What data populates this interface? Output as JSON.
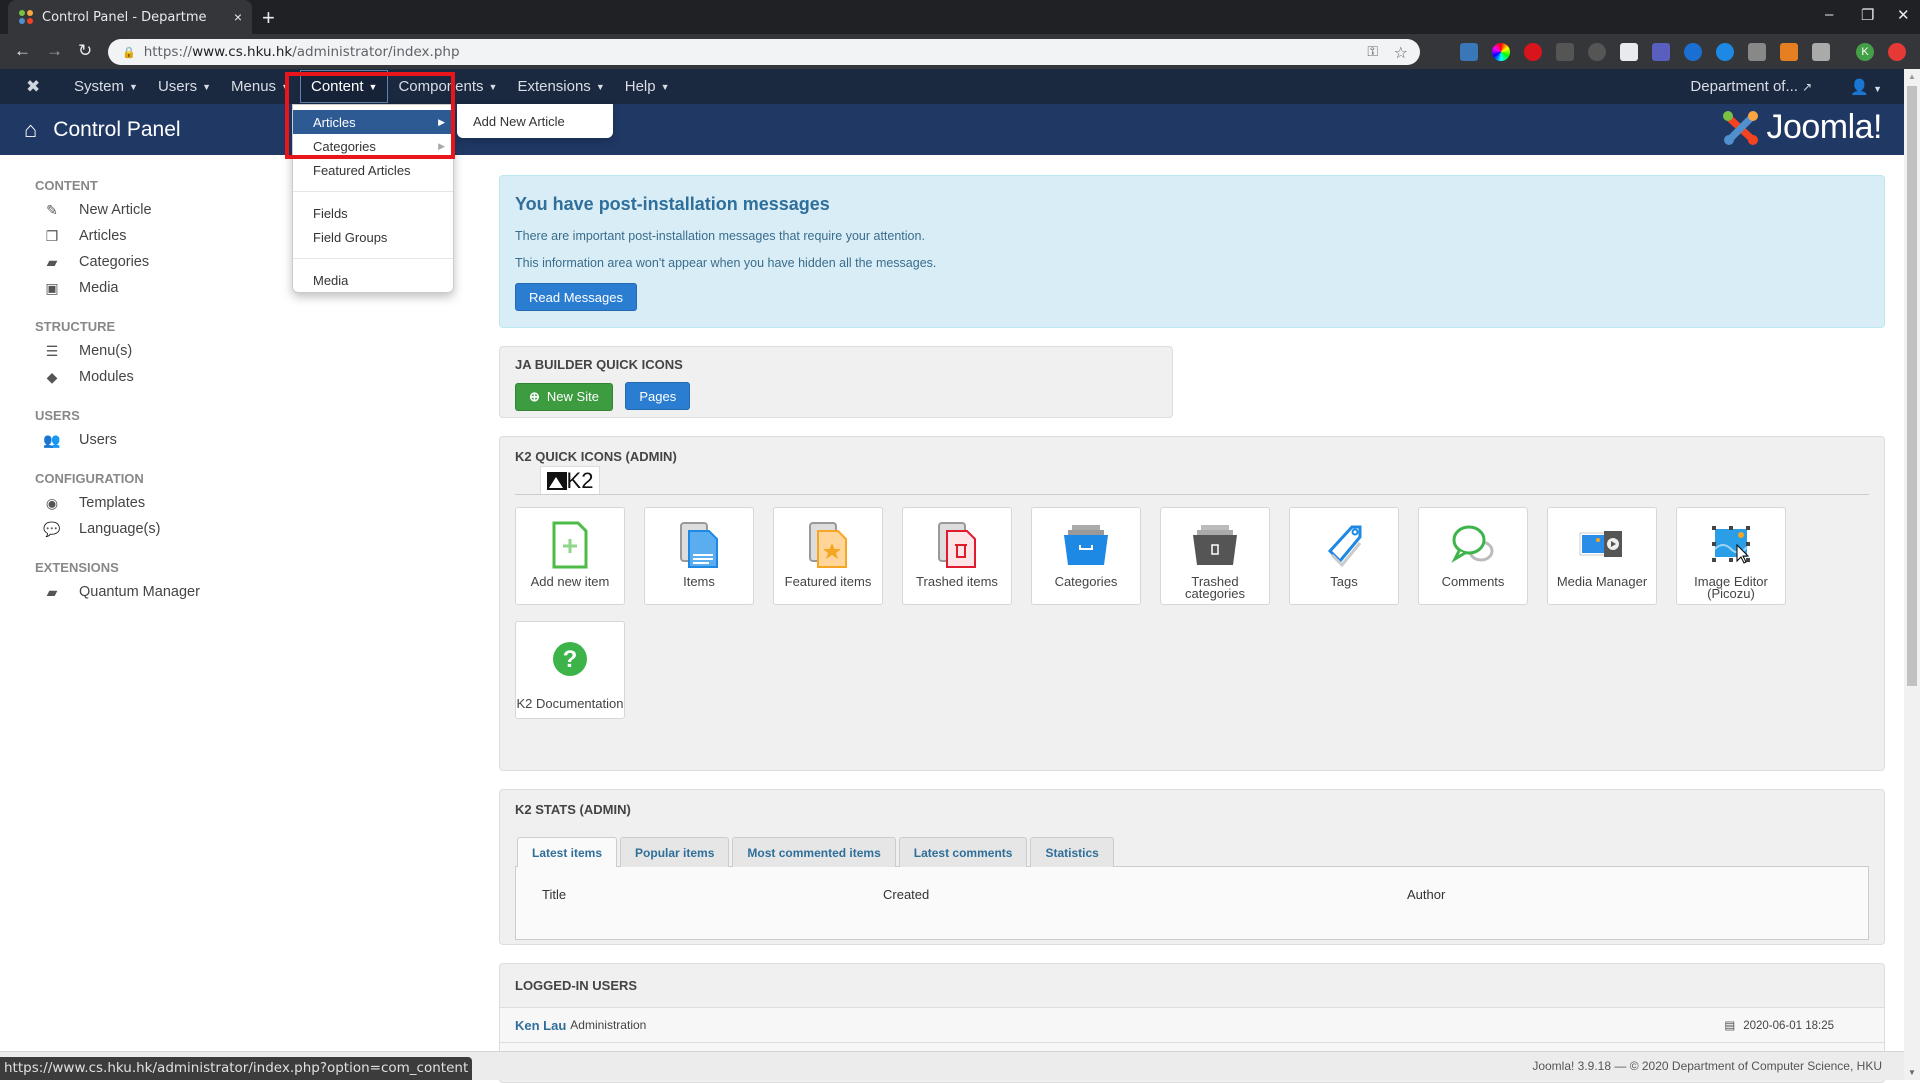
{
  "browser": {
    "tab_title": "Control Panel - Departme",
    "tab_close": "×",
    "new_tab": "+",
    "url_scheme": "https://",
    "url_host": "www.cs.hku.hk",
    "url_path": "/administrator/index.php",
    "status_url": "https://www.cs.hku.hk/administrator/index.php?option=com_content",
    "profile_initial": "K",
    "window_controls": {
      "minimize": "–",
      "restore": "❐",
      "close": "✕"
    }
  },
  "navbar": {
    "items": [
      {
        "label": "System"
      },
      {
        "label": "Users"
      },
      {
        "label": "Menus"
      },
      {
        "label": "Content",
        "active": true
      },
      {
        "label": "Components"
      },
      {
        "label": "Extensions"
      },
      {
        "label": "Help"
      }
    ],
    "site_link": "Department of...",
    "user_menu_icon": "user-icon"
  },
  "subhead": {
    "title": "Control Panel",
    "brand": "Joomla!"
  },
  "content_menu": {
    "items": [
      {
        "label": "Articles",
        "submenu": true,
        "highlighted": true
      },
      {
        "label": "Categories",
        "submenu": true
      },
      {
        "label": "Featured Articles"
      },
      {
        "label": "Fields"
      },
      {
        "label": "Field Groups"
      },
      {
        "label": "Media"
      }
    ],
    "articles_submenu": [
      {
        "label": "Add New Article"
      }
    ]
  },
  "sidebar": {
    "sections": [
      {
        "heading": "CONTENT",
        "items": [
          {
            "label": "New Article",
            "icon": "pencil-icon"
          },
          {
            "label": "Articles",
            "icon": "copy-icon"
          },
          {
            "label": "Categories",
            "icon": "folder-icon"
          },
          {
            "label": "Media",
            "icon": "image-icon"
          }
        ]
      },
      {
        "heading": "STRUCTURE",
        "items": [
          {
            "label": "Menu(s)",
            "icon": "list-icon"
          },
          {
            "label": "Modules",
            "icon": "cube-icon"
          }
        ]
      },
      {
        "heading": "USERS",
        "items": [
          {
            "label": "Users",
            "icon": "users-icon"
          }
        ]
      },
      {
        "heading": "CONFIGURATION",
        "items": [
          {
            "label": "Templates",
            "icon": "eye-icon"
          },
          {
            "label": "Language(s)",
            "icon": "comments-icon"
          }
        ]
      },
      {
        "heading": "EXTENSIONS",
        "items": [
          {
            "label": "Quantum Manager",
            "icon": "folder-icon"
          }
        ]
      }
    ]
  },
  "postinstall": {
    "title": "You have post-installation messages",
    "line1": "There are important post-installation messages that require your attention.",
    "line2": "This information area won't appear when you have hidden all the messages.",
    "button": "Read Messages"
  },
  "ja_builder": {
    "heading": "JA BUILDER QUICK ICONS",
    "new_site": "New Site",
    "pages": "Pages"
  },
  "k2_quick": {
    "heading": "K2 QUICK ICONS (ADMIN)",
    "logo_text": "K2",
    "icons": [
      {
        "label": "Add new item",
        "icon": "add-item-icon"
      },
      {
        "label": "Items",
        "icon": "items-icon"
      },
      {
        "label": "Featured items",
        "icon": "featured-items-icon"
      },
      {
        "label": "Trashed items",
        "icon": "trashed-items-icon"
      },
      {
        "label": "Categories",
        "icon": "categories-icon"
      },
      {
        "label": "Trashed categories",
        "icon": "trashed-categories-icon"
      },
      {
        "label": "Tags",
        "icon": "tag-icon"
      },
      {
        "label": "Comments",
        "icon": "comments-icon"
      },
      {
        "label": "Media Manager",
        "icon": "media-manager-icon"
      },
      {
        "label": "Image Editor (Picozu)",
        "icon": "image-editor-icon"
      },
      {
        "label": "K2 Documentation",
        "icon": "help-icon"
      }
    ]
  },
  "k2_stats": {
    "heading": "K2 STATS (ADMIN)",
    "tabs": [
      {
        "label": "Latest items",
        "active": true
      },
      {
        "label": "Popular items"
      },
      {
        "label": "Most commented items"
      },
      {
        "label": "Latest comments"
      },
      {
        "label": "Statistics"
      }
    ],
    "columns": [
      "Title",
      "Created",
      "Author"
    ]
  },
  "logged_in": {
    "heading": "LOGGED-IN USERS",
    "rows": [
      {
        "name": "Ken Lau",
        "role": "Administration",
        "date": "2020-06-01 18:25"
      },
      {
        "name": "",
        "role": "",
        "date": ""
      }
    ]
  },
  "footer": {
    "text": "Joomla! 3.9.18 — © 2020 Department of Computer Science, HKU"
  },
  "colors": {
    "navbar_bg": "#1a2840",
    "subhead_bg": "#1f3864",
    "menu_highlight": "#2d5a93",
    "annotation_red": "#e8151b",
    "primary_button": "#2a7dd1",
    "success_button": "#3c9c3f"
  }
}
